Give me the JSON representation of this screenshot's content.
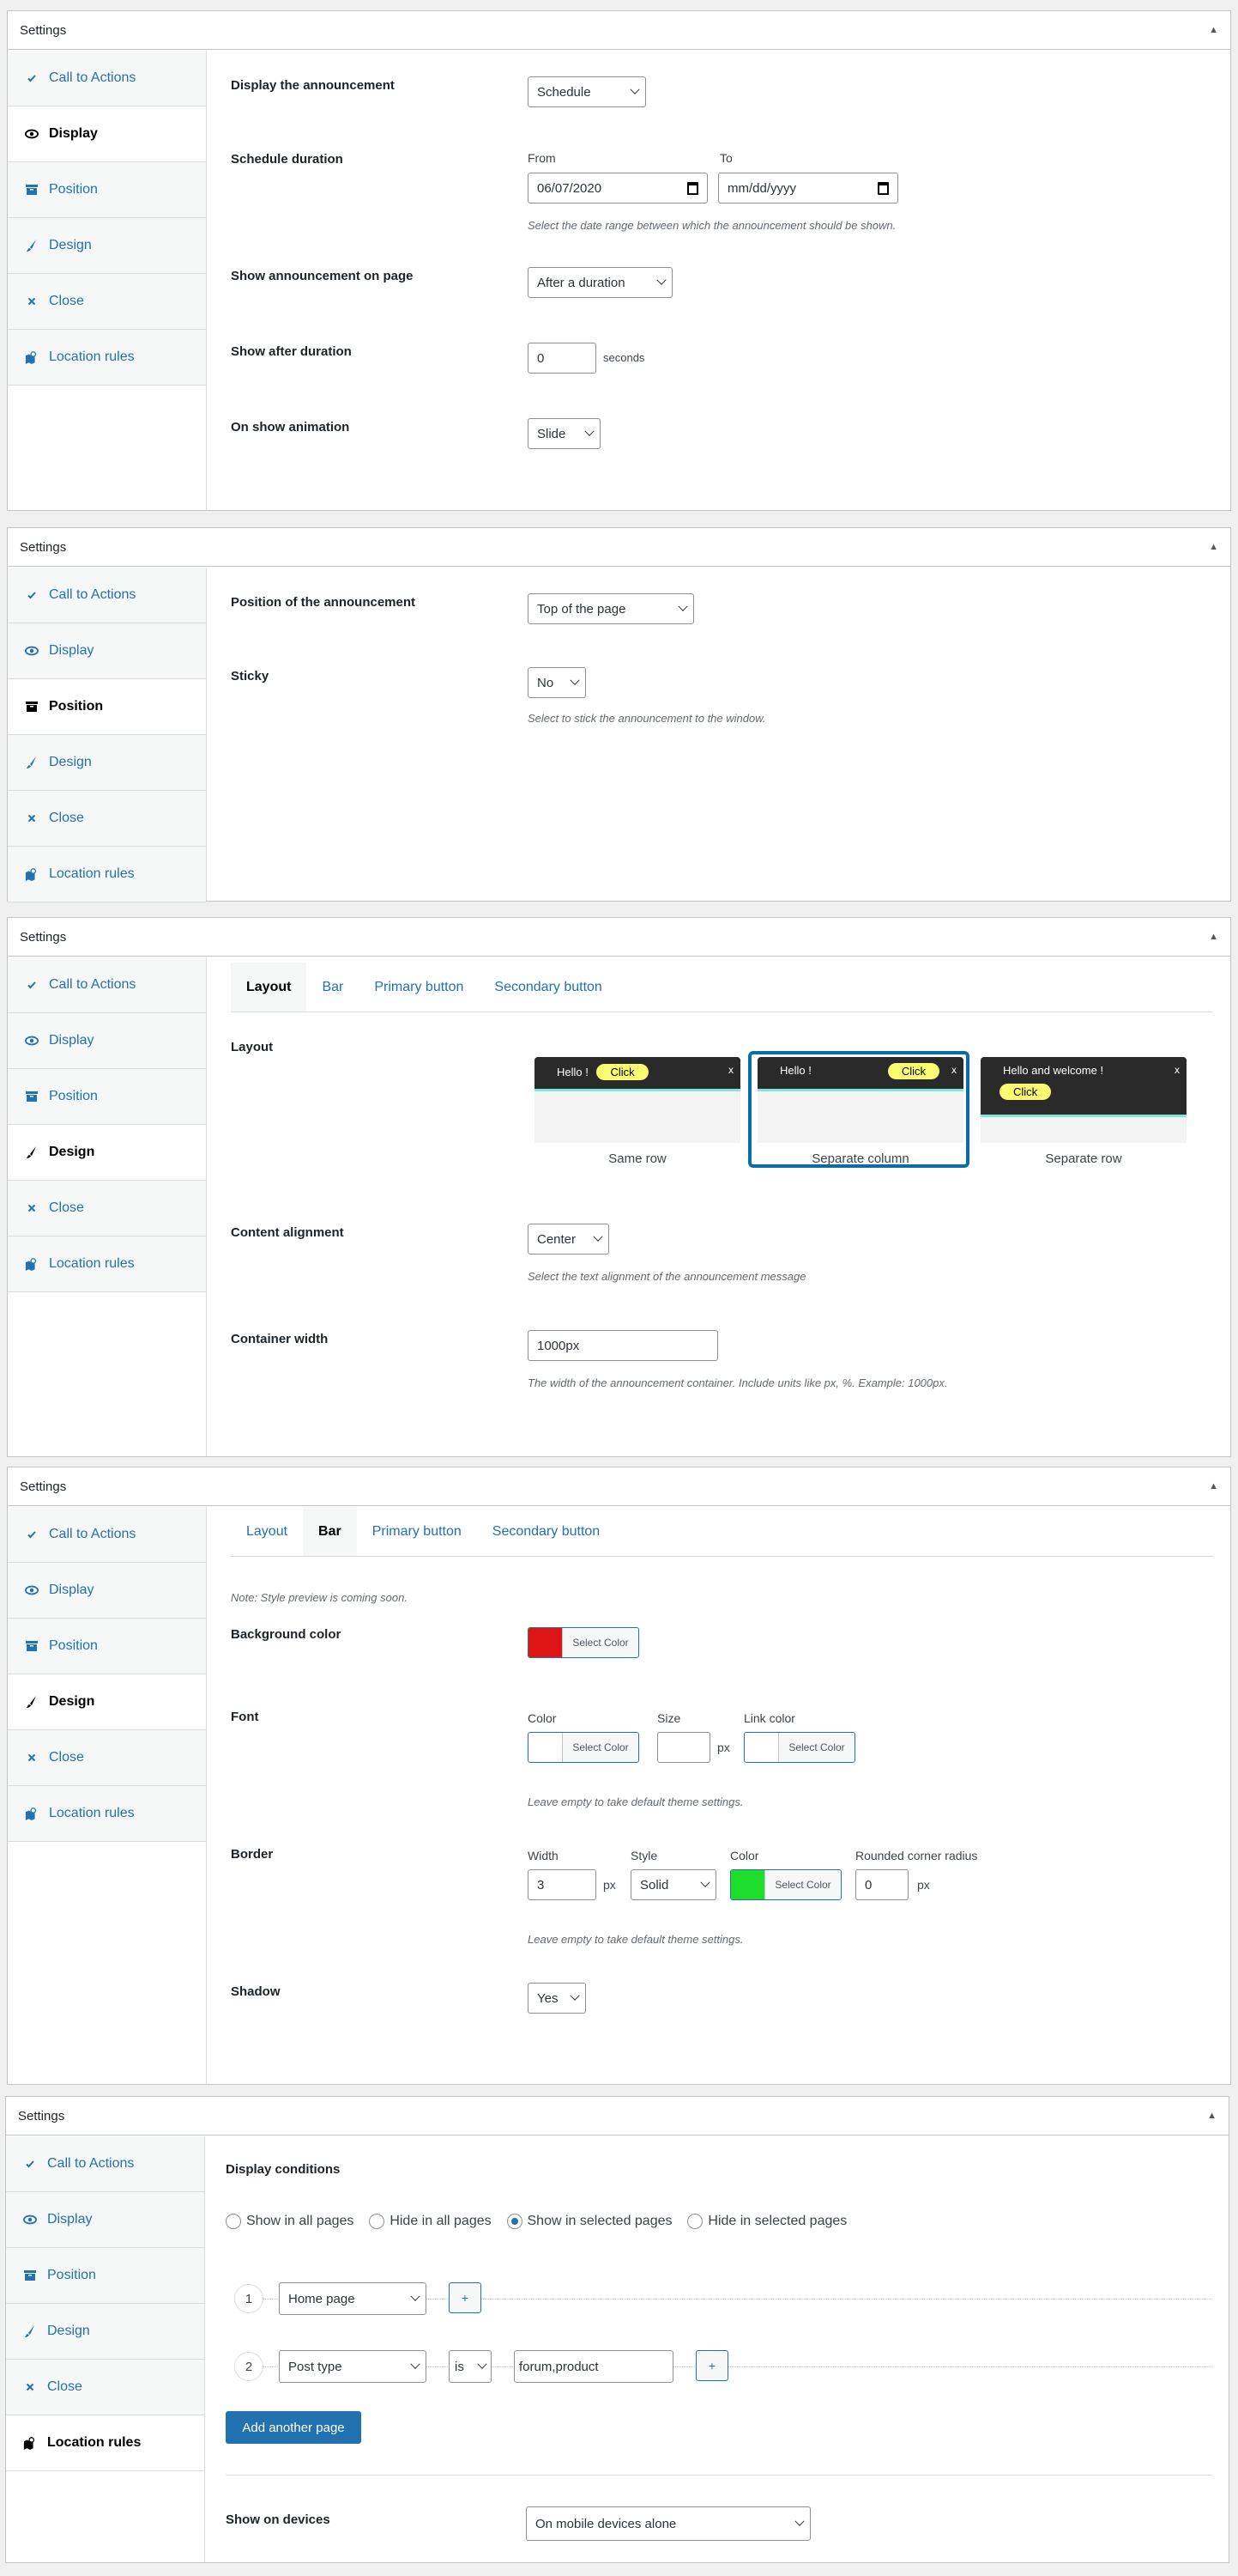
{
  "sidebar_items": [
    {
      "key": "cta",
      "label": "Call to Actions",
      "icon": "check-icon"
    },
    {
      "key": "display",
      "label": "Display",
      "icon": "eye-icon"
    },
    {
      "key": "position",
      "label": "Position",
      "icon": "archive-box-icon"
    },
    {
      "key": "design",
      "label": "Design",
      "icon": "brush-icon"
    },
    {
      "key": "close",
      "label": "Close",
      "icon": "close-icon"
    },
    {
      "key": "location",
      "label": "Location rules",
      "icon": "map-pin-icon"
    }
  ],
  "panel_title": "Settings",
  "toggle_icon": "▲",
  "panels": {
    "display": {
      "active": "Display",
      "display_announcement": {
        "label": "Display the announcement",
        "value": "Schedule"
      },
      "schedule_duration": {
        "label": "Schedule duration",
        "from_label": "From",
        "from_value": "06/07/2020",
        "to_label": "To",
        "to_placeholder": "mm/dd/yyyy",
        "description": "Select the date range between which the announcement should be shown."
      },
      "show_on_page": {
        "label": "Show announcement on page",
        "value": "After a duration"
      },
      "show_after": {
        "label": "Show after duration",
        "value": "0",
        "unit": "seconds"
      },
      "animation": {
        "label": "On show animation",
        "value": "Slide"
      }
    },
    "position": {
      "active": "Position",
      "position": {
        "label": "Position of the announcement",
        "value": "Top of the page"
      },
      "sticky": {
        "label": "Sticky",
        "value": "No",
        "description": "Select to stick the announcement to the window."
      }
    },
    "design_layout": {
      "active": "Design",
      "tabs": [
        "Layout",
        "Bar",
        "Primary button",
        "Secondary button"
      ],
      "active_tab": "Layout",
      "layout": {
        "label": "Layout",
        "options": [
          {
            "caption": "Same row",
            "message": "Hello !",
            "button": "Click",
            "close": "x",
            "selected": false
          },
          {
            "caption": "Separate column",
            "message": "Hello !",
            "button": "Click",
            "close": "x",
            "selected": true
          },
          {
            "caption": "Separate row",
            "message": "Hello and welcome !",
            "button": "Click",
            "close": "x",
            "selected": false
          }
        ]
      },
      "alignment": {
        "label": "Content alignment",
        "value": "Center",
        "description": "Select the text alignment of the announcement message"
      },
      "container_width": {
        "label": "Container width",
        "value": "1000px",
        "description": "The width of the announcement container. Include units like px, %. Example: 1000px."
      }
    },
    "design_bar": {
      "active": "Design",
      "tabs": [
        "Layout",
        "Bar",
        "Primary button",
        "Secondary button"
      ],
      "active_tab": "Bar",
      "note": "Note: Style preview is coming soon.",
      "background": {
        "label": "Background color",
        "button": "Select Color",
        "color": "#dd1515"
      },
      "font": {
        "label": "Font",
        "color_label": "Color",
        "color_button": "Select Color",
        "color_value": "",
        "size_label": "Size",
        "size_value": "",
        "size_unit": "px",
        "link_label": "Link color",
        "link_button": "Select Color",
        "link_value": "",
        "description": "Leave empty to take default theme settings."
      },
      "border": {
        "label": "Border",
        "width_label": "Width",
        "width_value": "3",
        "width_unit": "px",
        "style_label": "Style",
        "style_value": "Solid",
        "color_label": "Color",
        "color_button": "Select Color",
        "color_value": "#1fdd2b",
        "radius_label": "Rounded corner radius",
        "radius_value": "0",
        "radius_unit": "px",
        "description": "Leave empty to take default theme settings."
      },
      "shadow": {
        "label": "Shadow",
        "value": "Yes"
      }
    },
    "location": {
      "active": "Location rules",
      "conditions_label": "Display conditions",
      "radios": [
        {
          "label": "Show in all pages",
          "checked": false
        },
        {
          "label": "Hide in all pages",
          "checked": false
        },
        {
          "label": "Show in selected pages",
          "checked": true
        },
        {
          "label": "Hide in selected pages",
          "checked": false
        }
      ],
      "rules": [
        {
          "num": "1",
          "type": "Home page"
        },
        {
          "num": "2",
          "type": "Post type",
          "operator": "is",
          "value": "forum,product"
        }
      ],
      "plus_label": "+",
      "add_button": "Add another page",
      "devices": {
        "label": "Show on devices",
        "value": "On mobile devices alone"
      }
    }
  }
}
